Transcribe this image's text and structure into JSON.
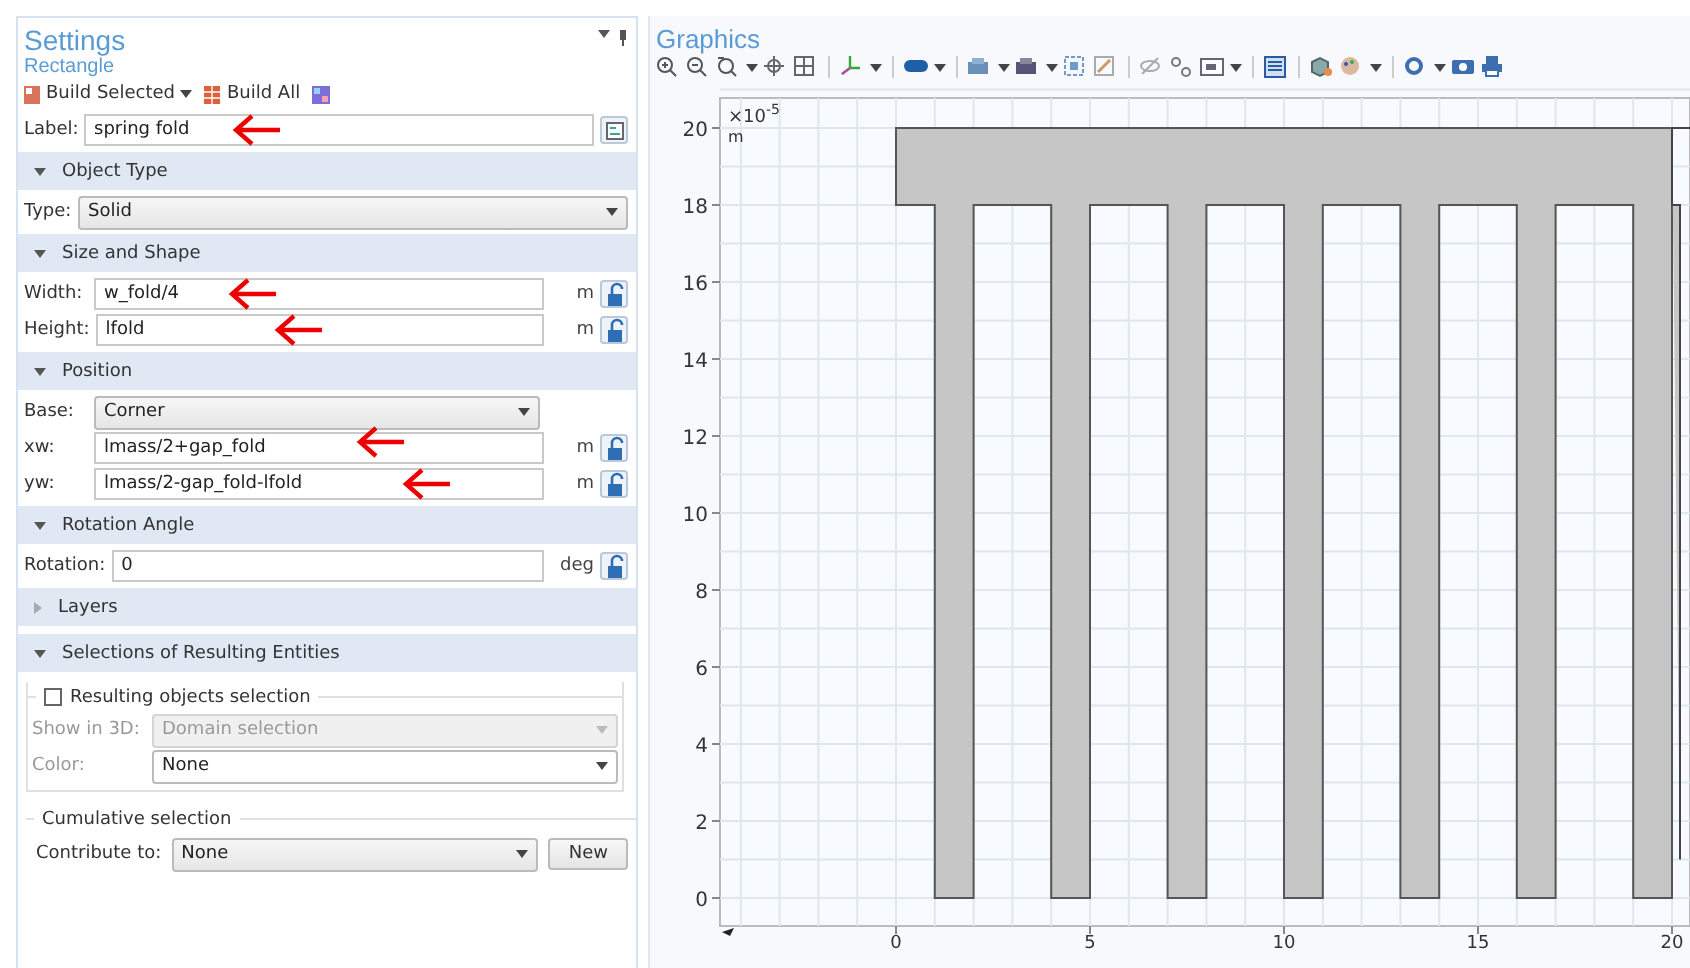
{
  "settings": {
    "title": "Settings",
    "subtitle": "Rectangle",
    "toolbar": [
      {
        "kind": "build_selected",
        "label": "Build Selected"
      },
      {
        "kind": "build_all",
        "label": "Build All"
      },
      {
        "kind": "icon"
      }
    ],
    "label_row": {
      "label": "Label:",
      "value": "spring fold",
      "annotated": true
    },
    "sections": [
      {
        "title": "Object Type",
        "expanded": true,
        "rows": [
          {
            "kind": "select",
            "label": "Type:",
            "value": "Solid",
            "unit": null,
            "annotated": false
          }
        ]
      },
      {
        "title": "Size and Shape",
        "expanded": true,
        "rows": [
          {
            "kind": "input",
            "label": "Width:",
            "value": "w_fold/4",
            "unit": "m",
            "annotated": true
          },
          {
            "kind": "input",
            "label": "Height:",
            "value": "lfold",
            "unit": "m",
            "annotated": true
          }
        ]
      },
      {
        "title": "Position",
        "expanded": true,
        "rows": [
          {
            "kind": "choice",
            "label": "Base:",
            "value": "Corner",
            "unit": null,
            "annotated": false
          },
          {
            "kind": "input",
            "label": "xw:",
            "value": "lmass/2+gap_fold",
            "unit": "m",
            "annotated": true
          },
          {
            "kind": "input",
            "label": "yw:",
            "value": "lmass/2-gap_fold-lfold",
            "unit": "m",
            "annotated": true
          }
        ]
      },
      {
        "title": "Rotation Angle",
        "expanded": true,
        "rows": [
          {
            "kind": "input",
            "label": "Rotation:",
            "value": "0",
            "unit": "deg",
            "annotated": false
          }
        ]
      },
      {
        "title": "Layers",
        "expanded": false
      },
      {
        "title": "Selections of Resulting Entities",
        "expanded": true
      }
    ],
    "selection_group": {
      "label": "Resulting objects selection",
      "checked": false,
      "rows": [
        {
          "label": "Show in 3D:",
          "value": "Domain selection",
          "disabled": true
        },
        {
          "label": "Color:",
          "value": "None",
          "disabled": false
        }
      ]
    },
    "cumulative": {
      "title": "Cumulative selection",
      "label": "Contribute to:",
      "value": "None",
      "button": "New"
    }
  },
  "graphics": {
    "title": "Graphics",
    "multiplier": "×10",
    "exponent": "-5",
    "unit": "m",
    "y_ticks": [
      "20",
      "18",
      "16",
      "14",
      "12",
      "10",
      "8",
      "6",
      "4",
      "2",
      "0"
    ],
    "x_ticks": [
      "0",
      "5",
      "10",
      "15",
      "20"
    ]
  }
}
